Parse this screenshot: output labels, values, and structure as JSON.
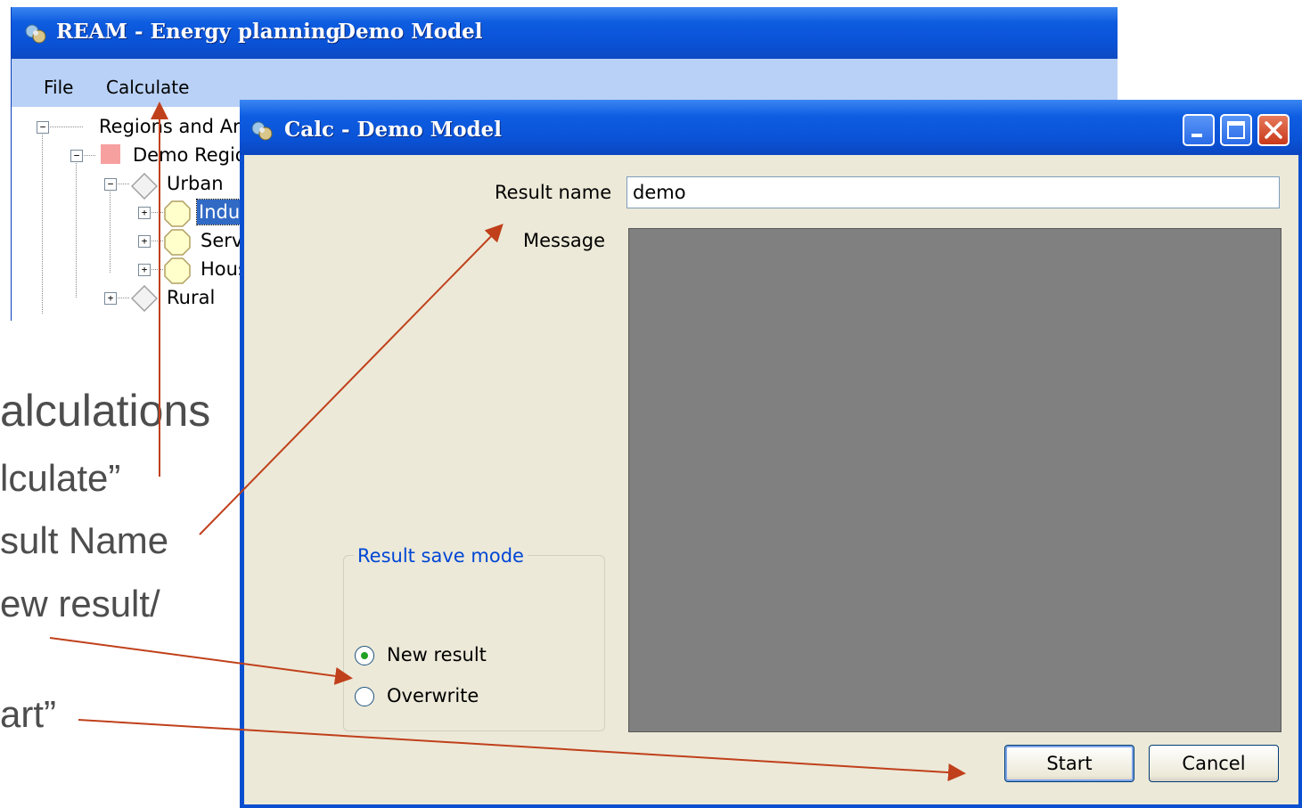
{
  "slide": {
    "heading": "alculations",
    "bullet1": "lculate”",
    "bullet2": "sult Name",
    "bullet3": "ew result/",
    "bullet4": "art”"
  },
  "main_window": {
    "title": "REAM - Energy planning",
    "model_name": "Demo Model",
    "menu": [
      "File",
      "Calculate"
    ],
    "tree": {
      "root": "Regions and Are",
      "region": "Demo Regio",
      "urban": "Urban",
      "sectors": [
        "Indu",
        "Serv",
        "Hous"
      ],
      "rural": "Rural"
    }
  },
  "dialog": {
    "title": "Calc - Demo Model",
    "result_name_label": "Result name",
    "result_name_value": "demo",
    "message_label": "Message",
    "save_mode_label": "Result save mode",
    "options": [
      "New result",
      "Overwrite"
    ],
    "selected_option": "New result",
    "start_label": "Start",
    "cancel_label": "Cancel"
  },
  "colors": {
    "arrow": "#c0401b",
    "titlebar": "#0a53d7",
    "dialog_bg": "#ece9d8",
    "message_bg": "#808080"
  }
}
